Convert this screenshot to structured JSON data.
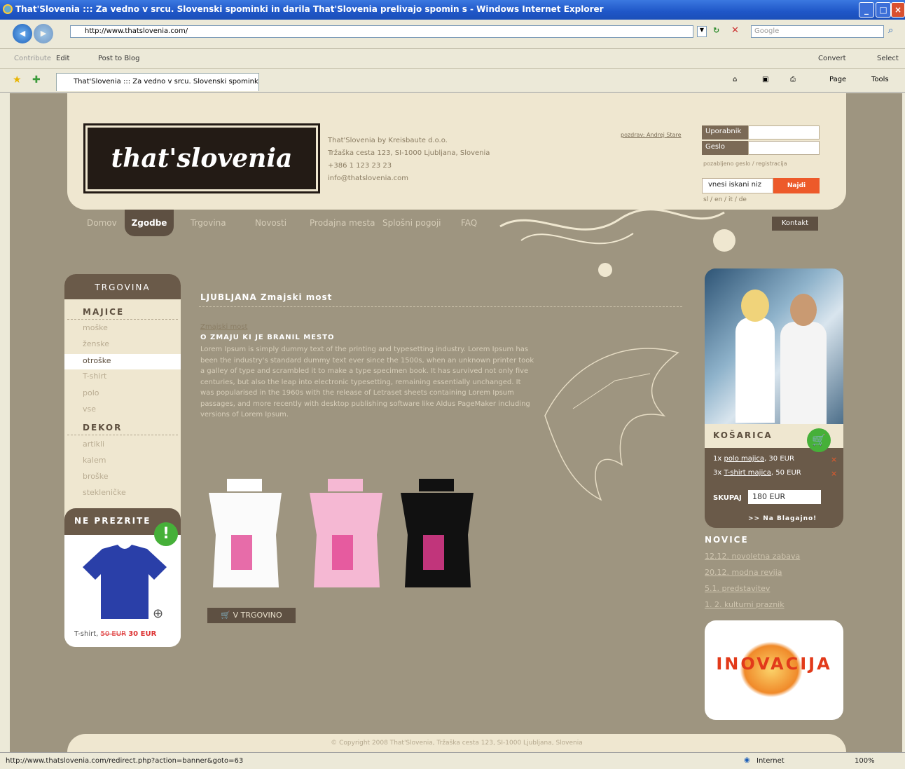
{
  "browser": {
    "title": "That'Slovenia ::: Za vedno v srcu. Slovenski spominki in darila That'Slovenia prelivajo spomin s - Windows Internet Explorer",
    "url": "http://www.thatslovenia.com/",
    "search_placeholder": "Google",
    "links_contribute": "Contribute",
    "links_edit": "Edit",
    "links_post": "Post to Blog",
    "convert": "Convert",
    "select": "Select",
    "tab_title": "That'Slovenia ::: Za vedno v srcu. Slovenski spominki i...",
    "page_menu": "Page",
    "tools_menu": "Tools",
    "status_url": "http://www.thatslovenia.com/redirect.php?action=banner&goto=63",
    "zone": "Internet",
    "zoom": "100%"
  },
  "header": {
    "logo": "that'slovenia",
    "address": [
      "That'Slovenia by Kreisbaute d.o.o.",
      "Tržaška cesta 123, SI-1000 Ljubljana, Slovenia",
      "+386 1 123 23 23",
      "info@thatslovenia.com"
    ],
    "login_note": "pozdrav: Andrej Stare",
    "user_label": "Uporabnik",
    "pass_label": "Geslo",
    "forgot": "pozabljeno geslo / registracija",
    "search_value": "vnesi iskani niz",
    "search_button": "Najdi",
    "languages": "sl / en / it / de"
  },
  "nav": {
    "items": [
      "Domov",
      "Zgodbe",
      "Trgovina",
      "Novosti",
      "Prodajna mesta",
      "Splošni pogoji",
      "FAQ"
    ],
    "kontakt": "Kontakt"
  },
  "sidebar": {
    "title": "TRGOVINA",
    "cat1": "MAJICE",
    "cat1_items": [
      "moške",
      "ženske",
      "otroške",
      "T-shirt",
      "polo",
      "vse"
    ],
    "cat2": "DEKOR",
    "cat2_items": [
      "artikli",
      "kalem",
      "broške",
      "stekleničke"
    ],
    "promo_title": "NE PREZRITE",
    "promo_price_label": "T-shirt,",
    "promo_old_price": "50 EUR",
    "promo_new_price": "30 EUR"
  },
  "content": {
    "title": "LJUBLJANA Zmajski most",
    "subtitle": "Zmajski most",
    "heading": "O ZMAJU KI JE BRANIL MESTO",
    "body": "Lorem Ipsum is simply dummy text of the printing and typesetting industry. Lorem Ipsum has been the industry's standard dummy text ever since the 1500s, when an unknown printer took a galley of type and scrambled it to make a type specimen book. It has survived not only five centuries, but also the leap into electronic typesetting, remaining essentially unchanged. It was popularised in the 1960s with the release of Letraset sheets containing Lorem Ipsum passages, and more recently with desktop publishing software like Aldus PageMaker including versions of Lorem Ipsum.",
    "shop_button": "V TRGOVINO"
  },
  "cart": {
    "title": "KOŠARICA",
    "line1_qty": "1x",
    "line1_item": "polo majica",
    "line1_price": "30 EUR",
    "line2_qty": "3x",
    "line2_item": "T-shirt majica",
    "line2_price": "50 EUR",
    "total_label": "SKUPAJ",
    "total_value": "180 EUR",
    "checkout": ">> Na Blagajno!"
  },
  "news": {
    "title": "NOVICE",
    "items": [
      "12.12. novoletna zabava",
      "20.12. modna revija",
      "5.1. predstavitev",
      "1. 2. kulturni praznik"
    ]
  },
  "banner": {
    "text": "INOVACIJA"
  },
  "footer": {
    "copyright": "© Copyright 2008 That'Slovenia, Tržaška cesta 123, SI-1000 Ljubljana, Slovenia"
  }
}
